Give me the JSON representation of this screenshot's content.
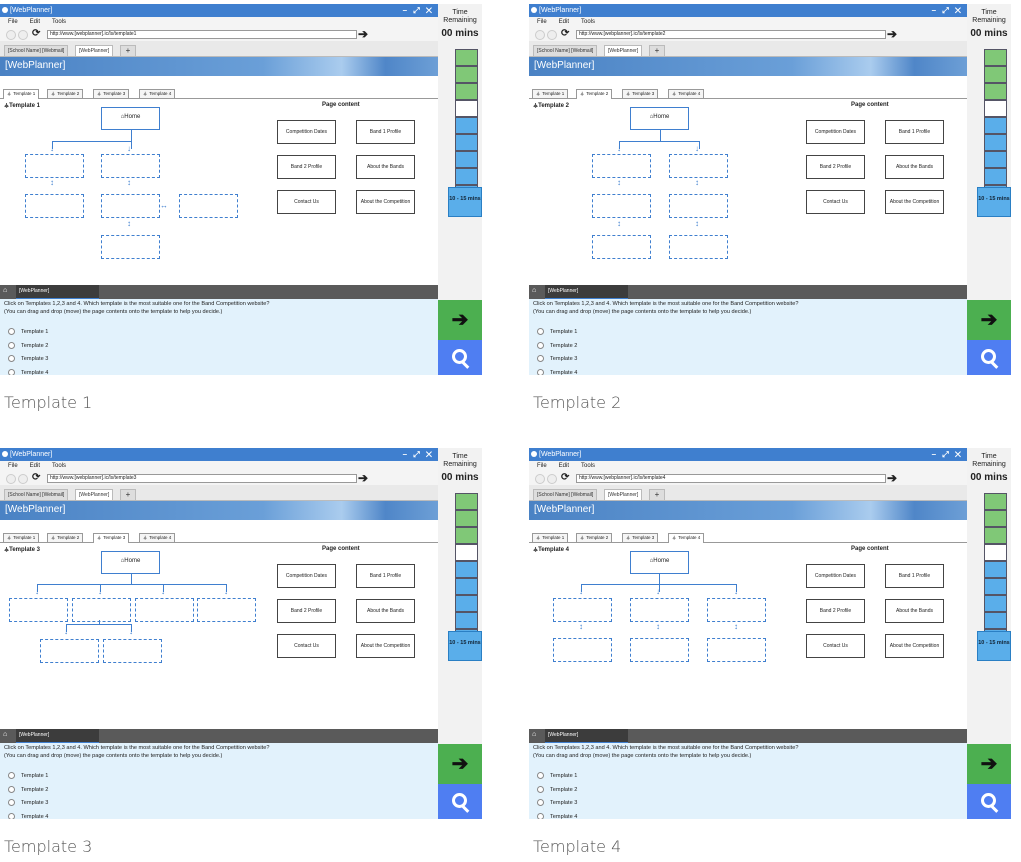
{
  "common": {
    "window_title": "[WebPlanner]",
    "window_controls": "– ⤢ ✕",
    "menu": [
      "File",
      "Edit",
      "Tools"
    ],
    "browser_tabs": [
      "[School Name] [Webmail]",
      "[WebPlanner]",
      "+"
    ],
    "banner": "[WebPlanner]",
    "template_tabs": [
      "Template 1",
      "Template 2",
      "Template 3",
      "Template 4"
    ],
    "page_content_title": "Page content",
    "home_label": "Home",
    "page_cards": [
      "Competition Dates",
      "Band 1 Profile",
      "Band 2 Profile",
      "About the Bands",
      "Contact Us",
      "About the Competition"
    ],
    "taskbar_tab": "[WebPlanner]",
    "question_line1": "Click on Templates 1,2,3 and 4. Which template is the most suitable one for the Band Competition website?",
    "question_line2": "(You can drag and drop (move) the page contents onto the template to help you decide.)",
    "options": [
      "Template 1",
      "Template 2",
      "Template 3",
      "Template 4"
    ],
    "time_label": "Time Remaining",
    "time_value": "00 mins",
    "time_box": "10 - 15 mins",
    "timer_segments": [
      "green",
      "green",
      "green",
      "white",
      "blue",
      "blue",
      "blue",
      "blue",
      "blue"
    ],
    "colors": {
      "titlebar": "#3f7fcf",
      "green": "#80c877",
      "blue_seg": "#5aaeea",
      "next": "#4caf50",
      "search": "#4f7ef2",
      "question_bg": "#e2f2fc"
    }
  },
  "panels": [
    {
      "url": "http://www.[webplanner].ic/ls/template1",
      "heading": "Template 1",
      "active_tab": 0,
      "caption": "Template 1"
    },
    {
      "url": "http://www.[webplanner].ic/ls/template2",
      "heading": "Template 2",
      "active_tab": 1,
      "caption": "Template 2"
    },
    {
      "url": "http://www.[webplanner].ic/ls/template3",
      "heading": "Template 3",
      "active_tab": 2,
      "caption": "Template 3"
    },
    {
      "url": "http://www.[webplanner].ic/ls/template4",
      "heading": "Template 4",
      "active_tab": 3,
      "caption": "Template 4"
    }
  ]
}
